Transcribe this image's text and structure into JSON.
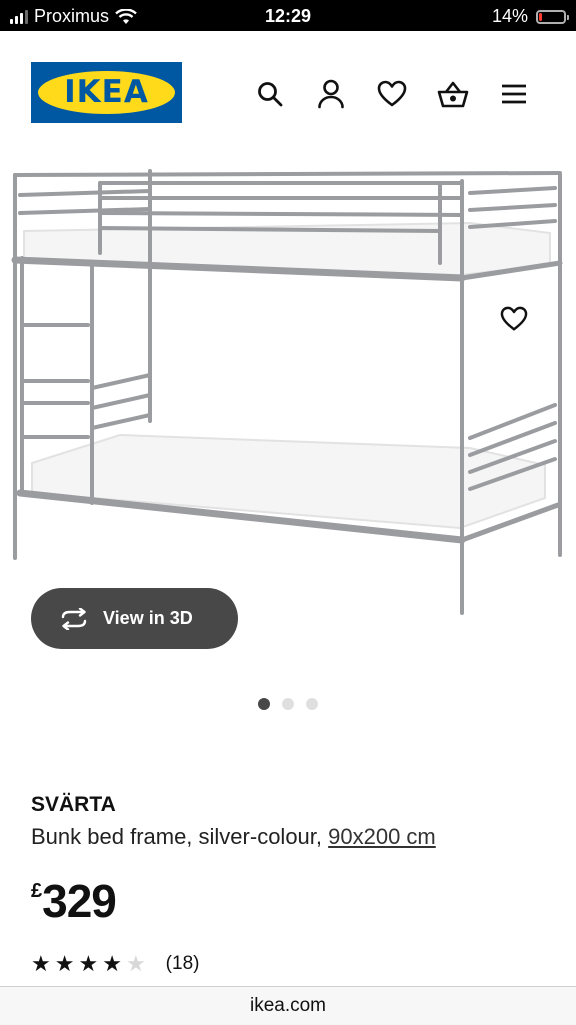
{
  "status_bar": {
    "carrier": "Proximus",
    "time": "12:29",
    "battery_percent": "14%",
    "battery_level": 0.14,
    "battery_color": "#ff3b30"
  },
  "header": {
    "logo_text": "IKEA",
    "brand_blue": "#0058a3",
    "brand_yellow": "#ffda1a",
    "icons": [
      "search-icon",
      "account-icon",
      "favourites-icon",
      "basket-icon",
      "menu-icon"
    ]
  },
  "product_image": {
    "favourite_icon": "heart-icon",
    "view_3d_label": "View in 3D",
    "view_3d_icon": "rotate-icon",
    "carousel_total": 3,
    "carousel_active": 0
  },
  "product": {
    "name": "SVÄRTA",
    "description": "Bunk bed frame, silver-colour, ",
    "size": "90x200 cm",
    "currency": "£",
    "price": "329",
    "rating_value": 4,
    "rating_max": 5,
    "review_count": "(18)"
  },
  "browser": {
    "url": "ikea.com"
  }
}
